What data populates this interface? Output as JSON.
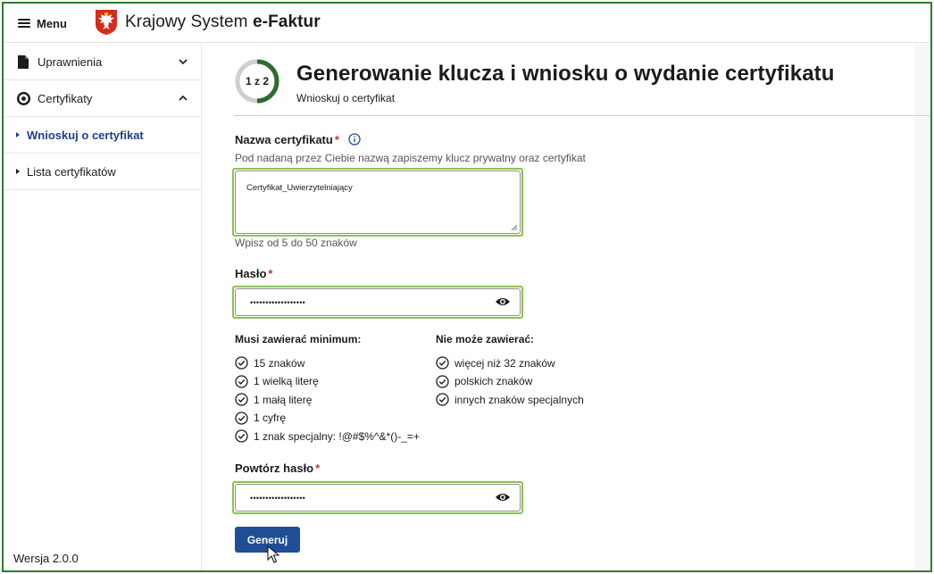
{
  "header": {
    "menu_label": "Menu",
    "brand_prefix": "Krajowy System ",
    "brand_bold": "e-Faktur"
  },
  "sidebar": {
    "items": [
      {
        "label": "Uprawnienia",
        "icon": "document-icon",
        "expanded": false
      },
      {
        "label": "Certyfikaty",
        "icon": "certificate-icon",
        "expanded": true
      }
    ],
    "subitems": [
      {
        "label": "Wnioskuj o certyfikat",
        "active": true
      },
      {
        "label": "Lista certyfikatów",
        "active": false
      }
    ],
    "version": "Wersja 2.0.0"
  },
  "main": {
    "step": {
      "label": "1 z 2",
      "current": 1,
      "total": 2
    },
    "title": "Generowanie klucza i wniosku o wydanie certyfikatu",
    "subtitle": "Wnioskuj o certyfikat",
    "certificate_name": {
      "label": "Nazwa certyfikatu",
      "required_mark": "*",
      "description": "Pod nadaną przez Ciebie nazwą zapiszemy klucz prywatny oraz certyfikat",
      "value": "Certyfikat_Uwierzytelniający",
      "hint": "Wpisz od 5 do 50 znaków"
    },
    "password": {
      "label": "Hasło",
      "required_mark": "*",
      "value_masked": "••••••••••••••••••"
    },
    "rules": {
      "must_title": "Musi zawierać minimum:",
      "must": [
        "15 znaków",
        "1 wielką literę",
        "1 małą literę",
        "1 cyfrę",
        "1 znak specjalny: !@#$%^&*()-_=+"
      ],
      "cannot_title": "Nie może zawierać:",
      "cannot": [
        "więcej niż 32 znaków",
        "polskich znaków",
        "innych znaków specjalnych"
      ]
    },
    "repeat_password": {
      "label": "Powtórz hasło",
      "required_mark": "*",
      "value_masked": "••••••••••••••••••"
    },
    "generate_button": "Generuj"
  },
  "colors": {
    "primary": "#1f4e96",
    "active_link": "#1f3f8c",
    "progress": "#2e6b2f",
    "progress_track": "#cfcfcf",
    "focus_outline": "#8cc152",
    "required": "#c0392b",
    "frame": "#2f7d32"
  }
}
